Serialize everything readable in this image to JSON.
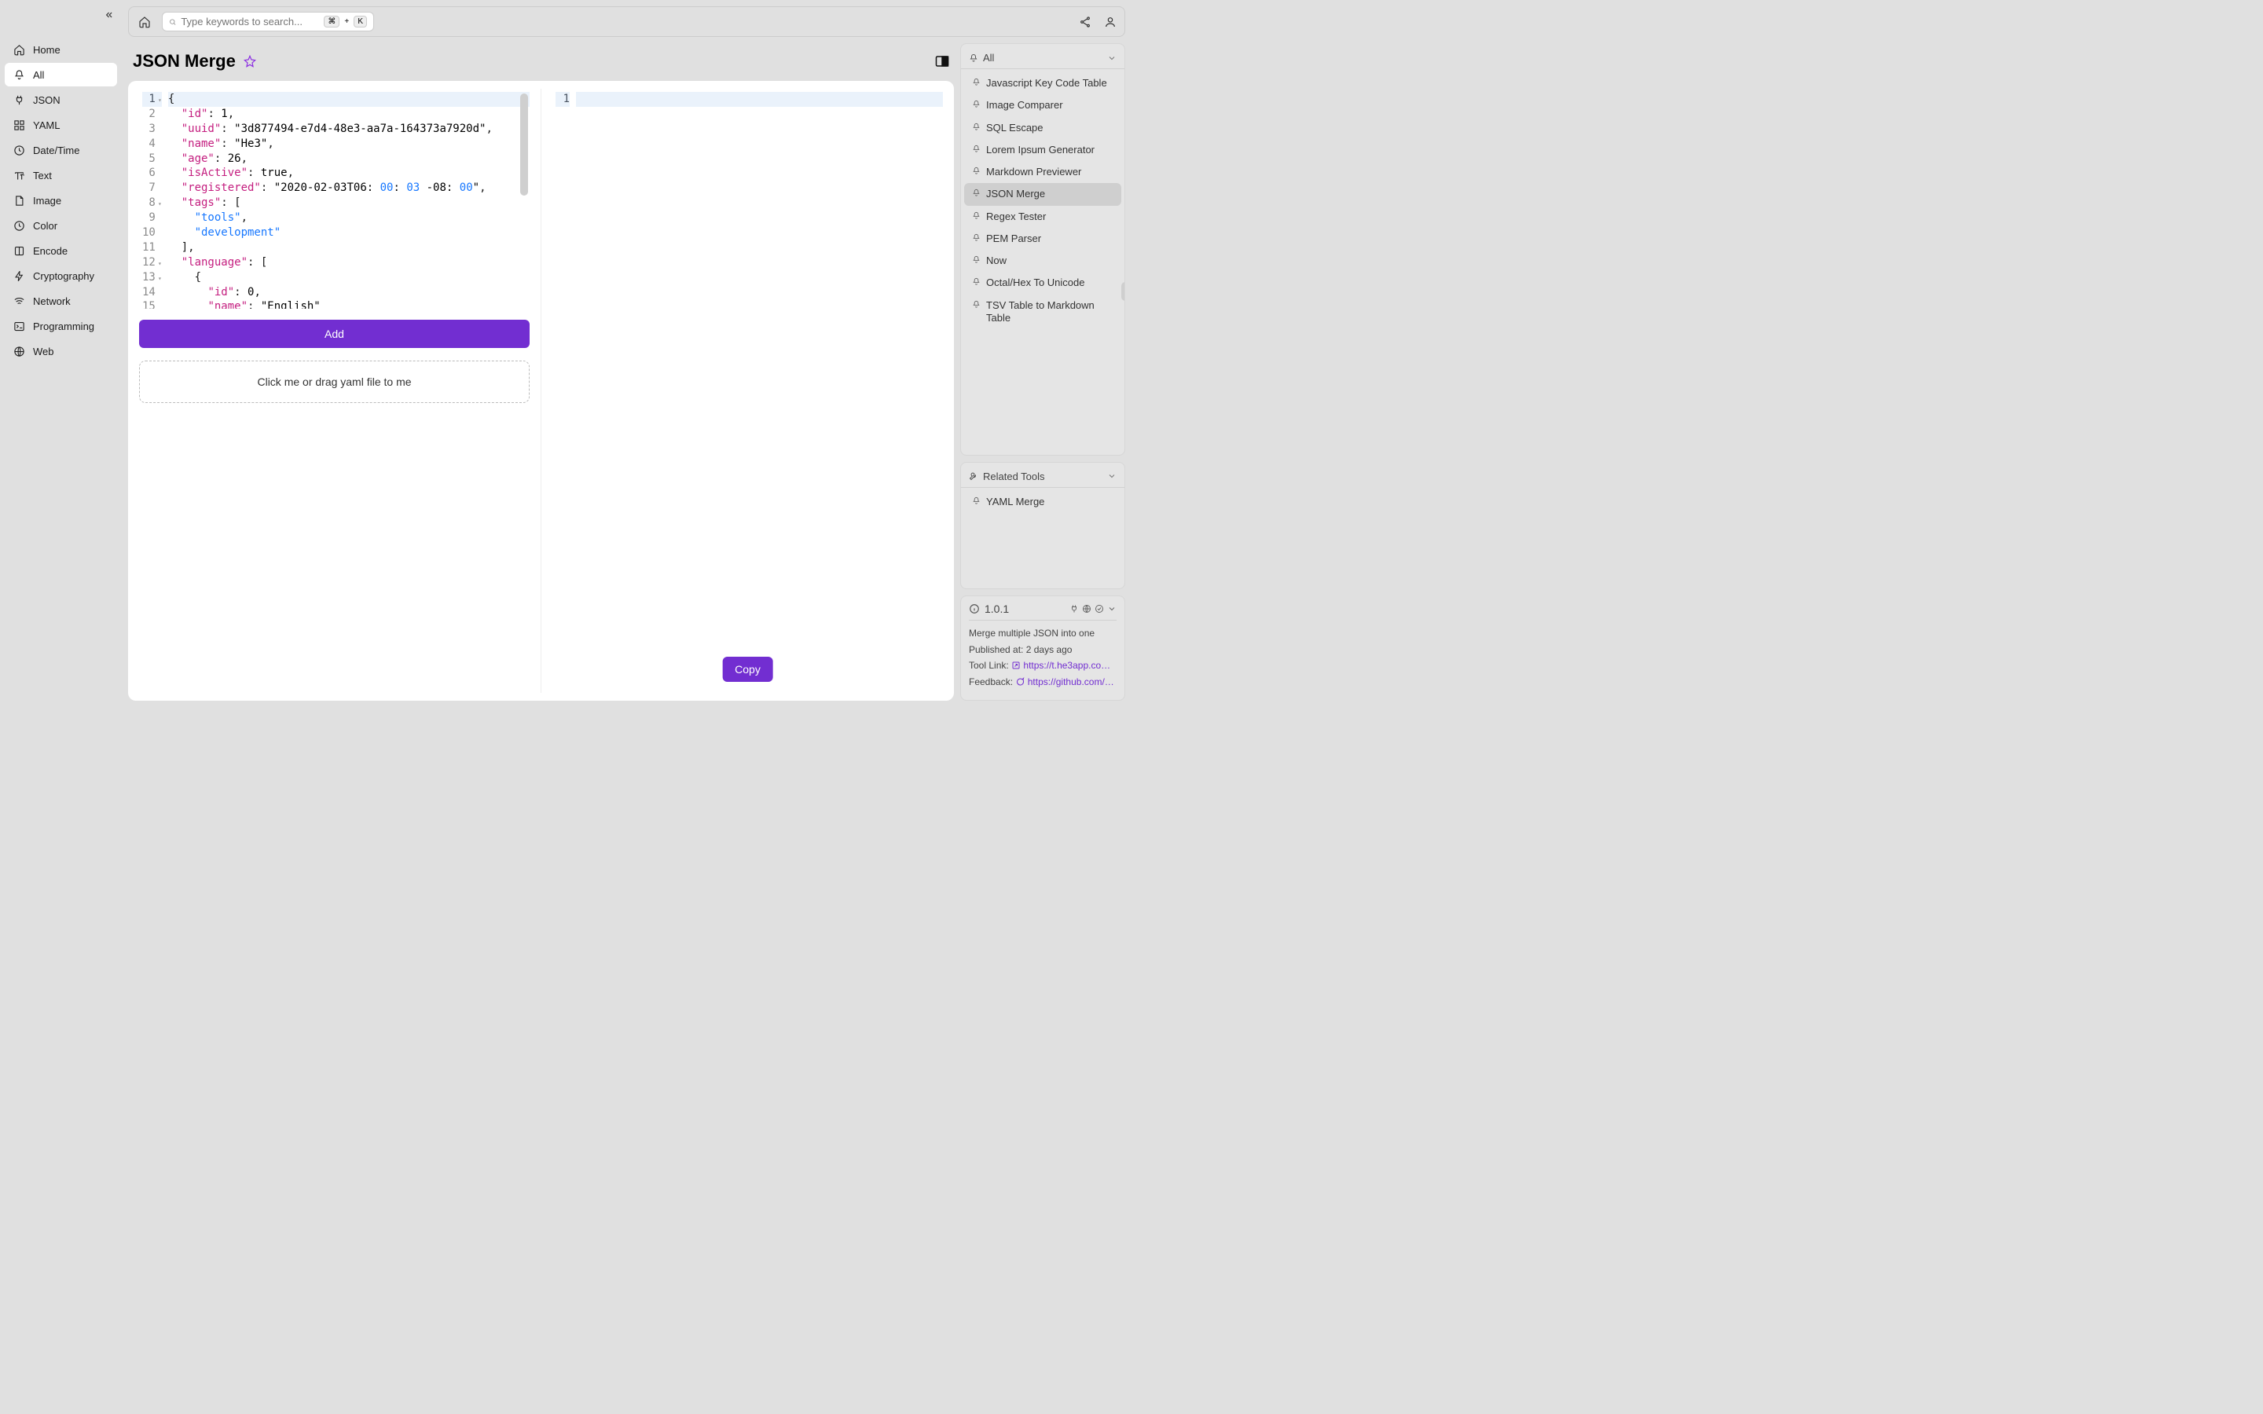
{
  "search": {
    "placeholder": "Type keywords to search...",
    "kbd_mod": "⌘",
    "kbd_plus": "+",
    "kbd_key": "K"
  },
  "sidebar": {
    "items": [
      {
        "label": "Home",
        "icon": "home-icon"
      },
      {
        "label": "All",
        "icon": "bell-icon"
      },
      {
        "label": "JSON",
        "icon": "plug-icon"
      },
      {
        "label": "YAML",
        "icon": "grid-icon"
      },
      {
        "label": "Date/Time",
        "icon": "clock-icon"
      },
      {
        "label": "Text",
        "icon": "text-icon"
      },
      {
        "label": "Image",
        "icon": "file-icon"
      },
      {
        "label": "Color",
        "icon": "clock-icon"
      },
      {
        "label": "Encode",
        "icon": "square-icon"
      },
      {
        "label": "Cryptography",
        "icon": "bolt-icon"
      },
      {
        "label": "Network",
        "icon": "wifi-icon"
      },
      {
        "label": "Programming",
        "icon": "terminal-icon"
      },
      {
        "label": "Web",
        "icon": "globe-icon"
      }
    ],
    "active": "All"
  },
  "page": {
    "title": "JSON Merge",
    "add_button": "Add",
    "dropzone": "Click me or drag yaml file to me",
    "copy_button": "Copy"
  },
  "editor": {
    "left_lines": [
      "{",
      "  \"id\": 1,",
      "  \"uuid\": \"3d877494-e7d4-48e3-aa7a-164373a7920d\",",
      "  \"name\": \"He3\",",
      "  \"age\": 26,",
      "  \"isActive\": true,",
      "  \"registered\": \"2020-02-03T06:00:03 -08:00\",",
      "  \"tags\": [",
      "    \"tools\",",
      "    \"development\"",
      "  ],",
      "  \"language\": [",
      "    {",
      "      \"id\": 0,",
      "      \"name\": \"English\""
    ],
    "left_line_count": 15,
    "right_line_count": 1,
    "fold_lines": [
      1,
      8,
      12,
      13
    ]
  },
  "rail": {
    "all_title": "All",
    "all_items": [
      "Javascript Key Code Table",
      "Image Comparer",
      "SQL Escape",
      "Lorem Ipsum Generator",
      "Markdown Previewer",
      "JSON Merge",
      "Regex Tester",
      "PEM Parser",
      "Now",
      "Octal/Hex To Unicode",
      "TSV Table to Markdown Table"
    ],
    "all_active": "JSON Merge",
    "related_title": "Related Tools",
    "related_items": [
      "YAML Merge"
    ]
  },
  "info": {
    "version": "1.0.1",
    "desc": "Merge multiple JSON into one",
    "published_label": "Published at:",
    "published_value": "2 days ago",
    "tool_link_label": "Tool Link:",
    "tool_link_value": "https://t.he3app.co…",
    "feedback_label": "Feedback:",
    "feedback_value": "https://github.com/…"
  }
}
